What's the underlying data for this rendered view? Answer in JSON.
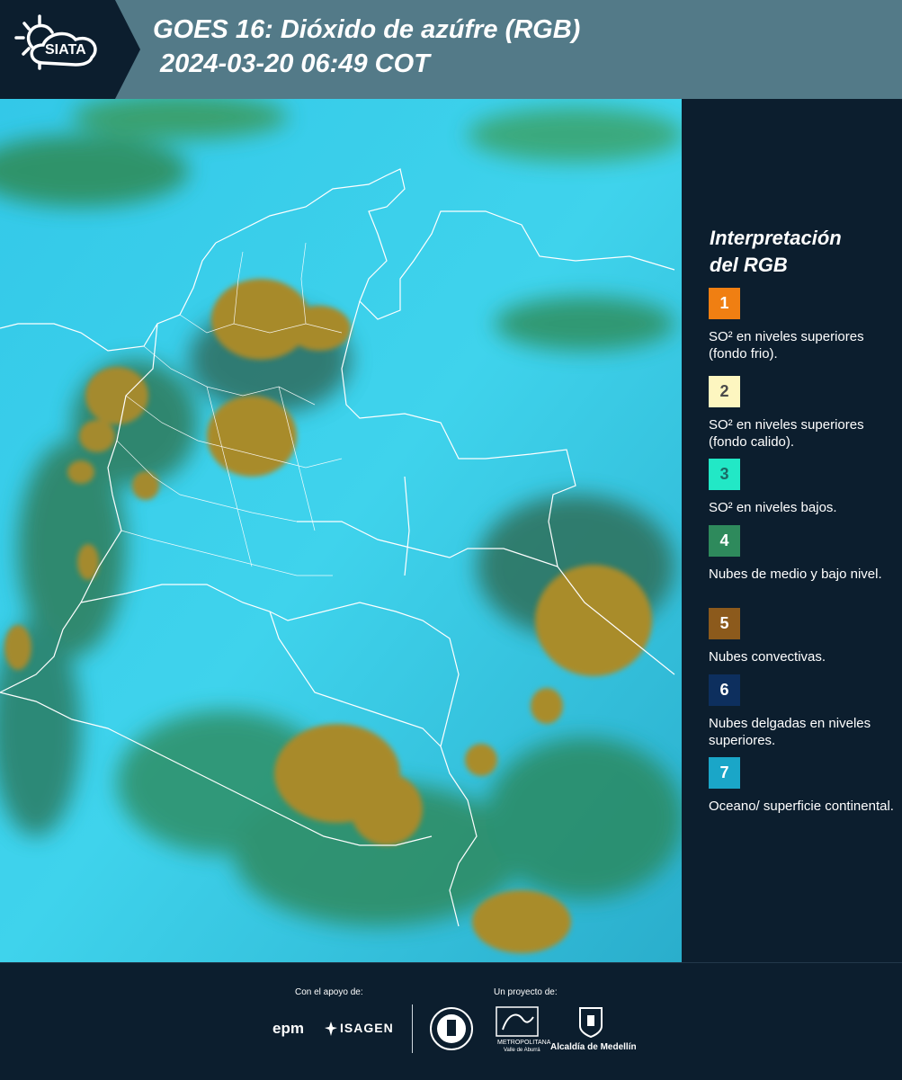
{
  "header": {
    "logo_text": "SIATA",
    "title_line1": "GOES 16: Dióxido de azúfre (RGB)",
    "title_line2": "2024-03-20 06:49 COT"
  },
  "legend": {
    "title_line1": "Interpretación",
    "title_line2": "del RGB",
    "items": [
      {
        "number": "1",
        "color": "#f07f12",
        "number_color": "#ffffff",
        "text": "SO² en niveles superiores (fondo frio)."
      },
      {
        "number": "2",
        "color": "#fdf6c0",
        "number_color": "#4a4a4a",
        "text": "SO² en niveles superiores (fondo calido)."
      },
      {
        "number": "3",
        "color": "#22e8c6",
        "number_color": "#1a6b66",
        "text": "SO² en niveles bajos."
      },
      {
        "number": "4",
        "color": "#2e8a5c",
        "number_color": "#ffffff",
        "text": "Nubes de medio y bajo nivel."
      },
      {
        "number": "5",
        "color": "#8c5a1c",
        "number_color": "#ffffff",
        "text": "Nubes convectivas."
      },
      {
        "number": "6",
        "color": "#0d2f5e",
        "number_color": "#ffffff",
        "text": "Nubes delgadas en niveles superiores."
      },
      {
        "number": "7",
        "color": "#1aa6c8",
        "number_color": "#ffffff",
        "text": "Oceano/ superficie continental."
      }
    ]
  },
  "footer": {
    "support_label": "Con el apoyo de:",
    "project_label": "Un proyecto de:",
    "sponsor1": "epm",
    "sponsor2": "ISAGEN",
    "partner2_line1": "METROPOLITANA",
    "partner2_line2": "Valle de Aburrá",
    "partner3": "Alcaldía de Medellín"
  }
}
